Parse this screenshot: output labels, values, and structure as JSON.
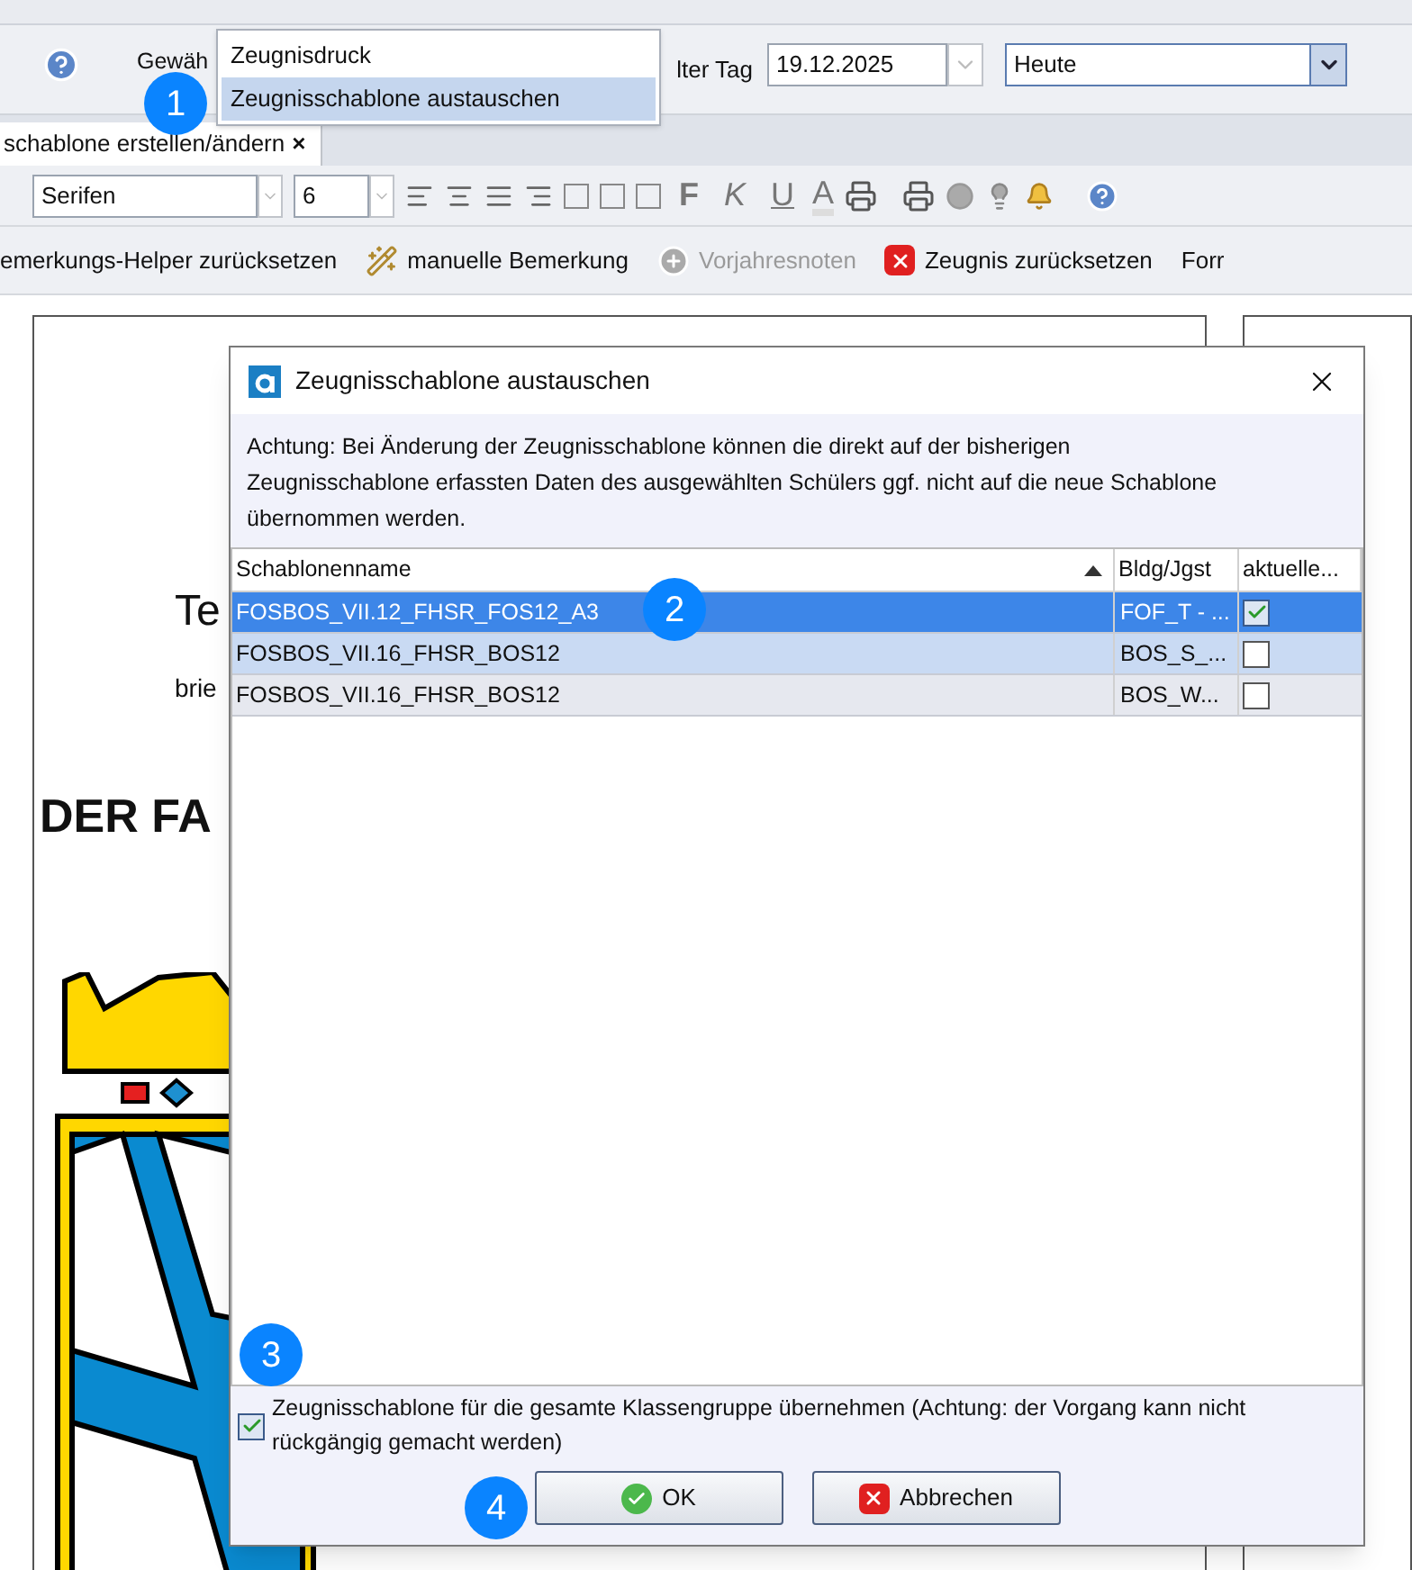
{
  "toolbar": {
    "chosen_label": "Gewäh",
    "day_label": "lter Tag",
    "date": "19.12.2025",
    "day_select": "Heute"
  },
  "menu": {
    "items": [
      {
        "label": "Zeugnisdruck",
        "selected": false
      },
      {
        "label": "Zeugnisschablone austauschen",
        "selected": true
      }
    ]
  },
  "document_tab": {
    "label": "schablone erstellen/ändern",
    "close": "×"
  },
  "format_bar": {
    "font": "Serifen",
    "size": "6",
    "bold": "F",
    "italic": "K",
    "underline": "U",
    "text_color_letter": "A"
  },
  "action_bar": [
    {
      "label": "emerkungs-Helper zurücksetzen",
      "kind": "plain",
      "disabled": false
    },
    {
      "label": "manuelle Bemerkung",
      "kind": "wand",
      "disabled": false
    },
    {
      "label": "Vorjahresnoten",
      "kind": "plus",
      "disabled": true
    },
    {
      "label": "Zeugnis zurücksetzen",
      "kind": "reset",
      "disabled": false
    },
    {
      "label": "Forr",
      "kind": "plain",
      "disabled": false
    }
  ],
  "document": {
    "line_1": "Te",
    "line_2": "brie",
    "heading": "DER FA"
  },
  "dialog": {
    "title": "Zeugnisschablone austauschen",
    "warning": "Achtung: Bei Änderung der Zeugnisschablone können die direkt auf der bisherigen Zeugnisschablone erfassten Daten des ausgewählten Schülers ggf. nicht auf die neue Schablone übernommen werden.",
    "table": {
      "columns": [
        {
          "label": "Schablonenname",
          "sorted": true
        },
        {
          "label": "Bldg/Jgst",
          "sorted": false
        },
        {
          "label": "aktuelle...",
          "sorted": false
        }
      ],
      "rows": [
        {
          "name": "FOSBOS_VII.12_FHSR_FOS12_A3",
          "bldg": "FOF_T - ...",
          "current": true,
          "selected": true
        },
        {
          "name": "FOSBOS_VII.16_FHSR_BOS12",
          "bldg": "BOS_S_...",
          "current": false,
          "selected": false
        },
        {
          "name": "FOSBOS_VII.16_FHSR_BOS12",
          "bldg": "BOS_W...",
          "current": false,
          "selected": false
        }
      ]
    },
    "apply_all": {
      "label": "Zeugnisschablone für die gesamte Klassengruppe übernehmen (Achtung: der Vorgang kann nicht rückgängig gemacht werden)",
      "checked": true
    },
    "buttons": [
      {
        "label": "OK",
        "kind": "ok"
      },
      {
        "label": "Abbrechen",
        "kind": "cancel"
      }
    ]
  },
  "callouts": [
    "1",
    "2",
    "3",
    "4"
  ]
}
